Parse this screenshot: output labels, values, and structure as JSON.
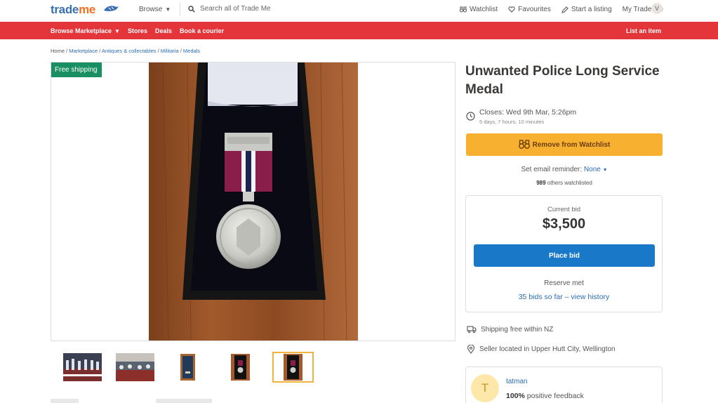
{
  "header": {
    "logo_part1": "trade",
    "logo_part2": "me",
    "browse_label": "Browse",
    "search_placeholder": "Search all of Trade Me",
    "watchlist_label": "Watchlist",
    "favourites_label": "Favourites",
    "start_listing_label": "Start a listing",
    "my_trade_me_label": "My Trade Me",
    "user_initial": "V"
  },
  "nav": {
    "browse_marketplace": "Browse Marketplace",
    "stores": "Stores",
    "deals": "Deals",
    "book_courier": "Book a courier",
    "list_item": "List an item"
  },
  "breadcrumb": {
    "home": "Home",
    "marketplace": "Marketplace",
    "category": "Antiques & collectables",
    "subcategory": "Militaria",
    "leaf": "Medals"
  },
  "gallery": {
    "badge": "Free shipping",
    "thumbnail_count": 5,
    "active_thumbnail": 5
  },
  "listing": {
    "title": "Unwanted Police Long Service Medal",
    "closes": "Closes: Wed 9th Mar, 5:26pm",
    "time_left": "5 days, 7 hours, 10 minutes",
    "watchlist_button": "Remove from Watchlist",
    "reminder_label": "Set email reminder:",
    "reminder_value": "None",
    "watchers_count": "989",
    "watchers_text": "others watchlisted"
  },
  "bid": {
    "label": "Current bid",
    "amount": "$3,500",
    "button": "Place bid",
    "reserve": "Reserve met",
    "history": "35 bids so far – view history"
  },
  "details": {
    "shipping": "Shipping free within NZ",
    "location": "Seller located in Upper Hutt City, Wellington"
  },
  "seller": {
    "initial": "T",
    "name": "tatman",
    "feedback_pct": "100%",
    "feedback_text": "positive feedback"
  },
  "colors": {
    "brand_red": "#e3353a",
    "watch_yellow": "#f7b030",
    "bid_blue": "#1a78c9",
    "free_ship_green": "#1a8f63",
    "link_blue": "#2a6db4"
  }
}
